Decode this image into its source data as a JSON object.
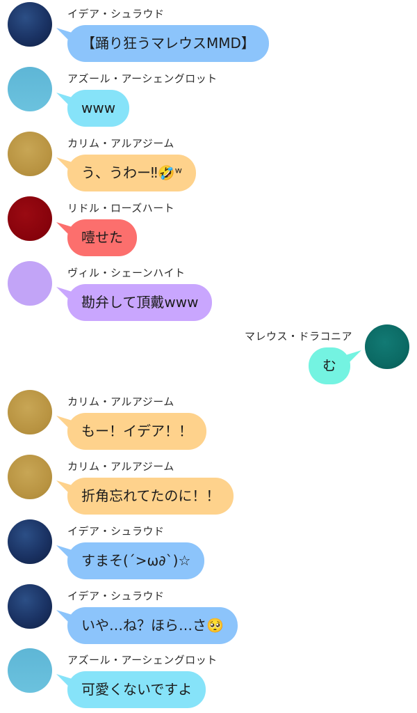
{
  "colors": {
    "idia": "#8cc4fb",
    "azul": "#86e3f9",
    "kalim": "#fed28c",
    "riddle": "#fc6f6d",
    "vil": "#c9a6fe",
    "malleus": "#74f3e1"
  },
  "messages": [
    {
      "sender": "イデア・シュラウド",
      "text": "【踊り狂うマレウスMMD】",
      "side": "left",
      "avatar": "navy-starry",
      "bubble_color": "#8cc4fb"
    },
    {
      "sender": "アズール・アーシェングロット",
      "text": "www",
      "side": "left",
      "avatar": "sky-blue",
      "bubble_color": "#86e3f9"
    },
    {
      "sender": "カリム・アルアジーム",
      "text": "う、うわー‼︎🤣ʷ",
      "side": "left",
      "avatar": "gold",
      "bubble_color": "#fed28c"
    },
    {
      "sender": "リドル・ローズハート",
      "text": "噎せた",
      "side": "left",
      "avatar": "crimson",
      "bubble_color": "#fc6f6d"
    },
    {
      "sender": "ヴィル・シェーンハイト",
      "text": "勘弁して頂戴www",
      "side": "left",
      "avatar": "lilac",
      "bubble_color": "#c9a6fe"
    },
    {
      "sender": "マレウス・ドラコニア",
      "text": "む",
      "side": "right",
      "avatar": "teal",
      "bubble_color": "#74f3e1"
    },
    {
      "sender": "カリム・アルアジーム",
      "text": "もー！イデア！！",
      "side": "left",
      "avatar": "gold",
      "bubble_color": "#fed28c"
    },
    {
      "sender": "カリム・アルアジーム",
      "text": "折角忘れてたのに！！",
      "side": "left",
      "avatar": "gold",
      "bubble_color": "#fed28c"
    },
    {
      "sender": "イデア・シュラウド",
      "text": "すまそ(´>ω∂`)☆",
      "side": "left",
      "avatar": "navy-starry",
      "bubble_color": "#8cc4fb"
    },
    {
      "sender": "イデア・シュラウド",
      "text": "いや…ね？ほら…さ🥺",
      "side": "left",
      "avatar": "navy-starry",
      "bubble_color": "#8cc4fb"
    },
    {
      "sender": "アズール・アーシェングロット",
      "text": "可愛くないですよ",
      "side": "left",
      "avatar": "sky-blue",
      "bubble_color": "#86e3f9"
    }
  ]
}
